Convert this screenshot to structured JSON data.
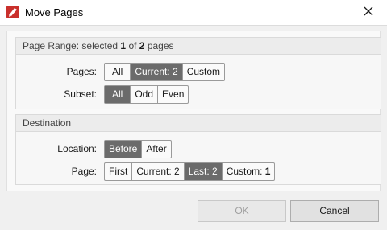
{
  "window": {
    "title": "Move Pages"
  },
  "page_range": {
    "header_prefix": "Page Range: selected ",
    "selected": "1",
    "header_mid": " of ",
    "total": "2",
    "header_suffix": " pages",
    "pages_label": "Pages:",
    "pages_options": {
      "all": "All",
      "current": "Current: 2",
      "custom": "Custom"
    },
    "subset_label": "Subset:",
    "subset_options": {
      "all": "All",
      "odd": "Odd",
      "even": "Even"
    }
  },
  "destination": {
    "header": "Destination",
    "location_label": "Location:",
    "location_options": {
      "before": "Before",
      "after": "After"
    },
    "page_label": "Page:",
    "page_options": {
      "first": "First",
      "current": "Current: 2",
      "last": "Last: 2",
      "custom_prefix": "Custom: ",
      "custom_value": "1"
    }
  },
  "buttons": {
    "ok": "OK",
    "cancel": "Cancel"
  },
  "colors": {
    "selected_segment": "#6b6b6b",
    "brand_red": "#c9302c"
  },
  "icons": {
    "app": "pdf-editor-icon",
    "close": "close-icon"
  }
}
